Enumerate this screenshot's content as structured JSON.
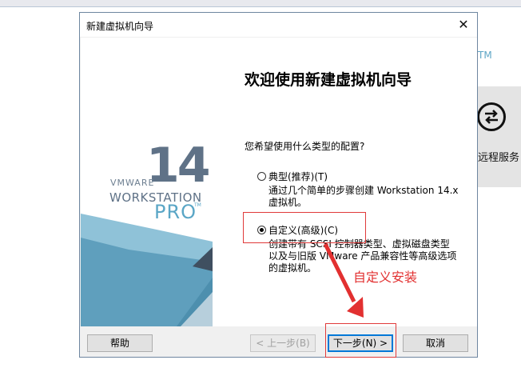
{
  "background": {
    "tm_text": "TM",
    "remote_label": "远程服务"
  },
  "dialog": {
    "title": "新建虚拟机向导",
    "close_symbol": "✕",
    "banner": {
      "vmware": "VMWARE",
      "version": "14",
      "product": "WORKSTATION",
      "edition": "PRO",
      "tm": "TM"
    },
    "heading": "欢迎使用新建虚拟机向导",
    "question": "您希望使用什么类型的配置?",
    "options": [
      {
        "label": "典型(推荐)(T)",
        "desc": [
          "通过几个简单的步骤创建 Workstation 14.x",
          "虚拟机。"
        ],
        "selected": false
      },
      {
        "label": "自定义(高级)(C)",
        "desc": [
          "创建带有 SCSI 控制器类型、虚拟磁盘类型",
          "以及与旧版 VMware 产品兼容性等高级选项",
          "的虚拟机。"
        ],
        "selected": true
      }
    ],
    "annotation": "自定义安装",
    "annotation_color": "#e23030",
    "buttons": {
      "help": "帮助",
      "back": "< 上一步(B)",
      "next": "下一步(N) >",
      "cancel": "取消"
    }
  }
}
